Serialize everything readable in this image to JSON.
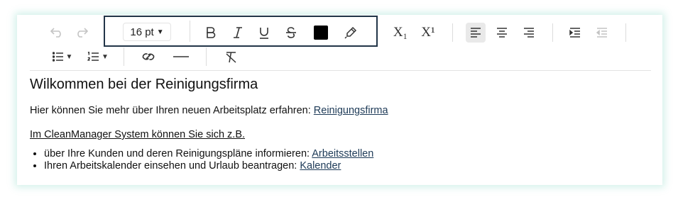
{
  "toolbar": {
    "font_size": "16 pt",
    "subscript_label": "X₁",
    "superscript_label": "X¹",
    "text_color": "#000000",
    "highlight_box_color": "#223548",
    "icons": [
      "undo-icon",
      "redo-icon",
      "bold-icon",
      "italic-icon",
      "underline-icon",
      "strikethrough-icon",
      "text-color-icon",
      "highlighter-icon",
      "subscript-icon",
      "superscript-icon",
      "align-left-icon",
      "align-center-icon",
      "align-right-icon",
      "indent-icon",
      "outdent-icon",
      "bullet-list-icon",
      "numbered-list-icon",
      "link-icon",
      "horizontal-rule-icon",
      "clear-format-icon"
    ]
  },
  "document": {
    "heading": "Wilkommen bei der Reinigungsfirma",
    "p1_text": "Hier können Sie mehr über Ihren neuen Arbeitsplatz erfahren: ",
    "p1_link": "Reinigungsfirma",
    "p2_text": "Im CleanManager System können Sie sich z.B.",
    "items": [
      {
        "text": "über Ihre Kunden und deren Reinigungspläne informieren: ",
        "link": "Arbeitsstellen"
      },
      {
        "text": "Ihren Arbeitskalender einsehen und Urlaub beantragen: ",
        "link": "Kalender"
      }
    ]
  }
}
